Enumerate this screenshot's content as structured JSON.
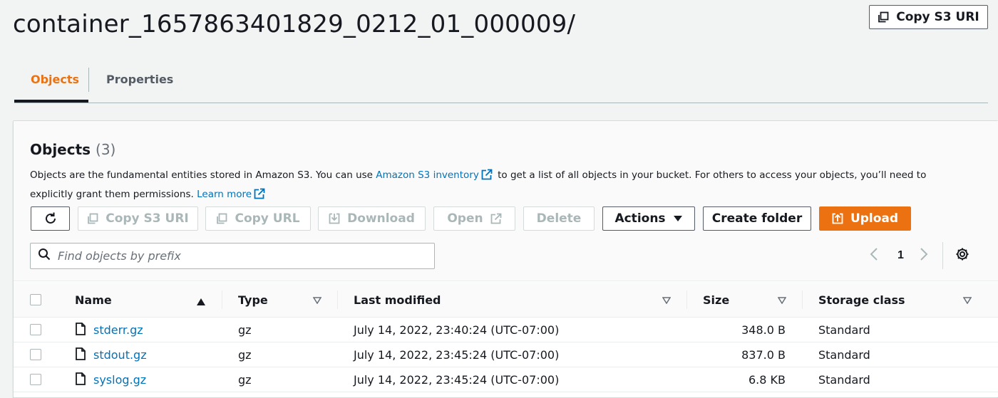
{
  "page": {
    "title": "container_1657863401829_0212_01_000009/",
    "copy_s3_uri_label": "Copy S3 URI"
  },
  "tabs": [
    {
      "label": "Objects",
      "active": true
    },
    {
      "label": "Properties",
      "active": false
    }
  ],
  "panel": {
    "title": "Objects",
    "count": "(3)",
    "description_part1": "Objects are the fundamental entities stored in Amazon S3. You can use ",
    "inventory_link": "Amazon S3 inventory",
    "description_part2": " to get a list of all objects in your bucket. For others to access your objects, you’ll need to explicitly grant them permissions. ",
    "learn_more_link": "Learn more"
  },
  "toolbar": {
    "refresh_icon": "refresh-icon",
    "copy_s3_uri_label": "Copy S3 URI",
    "copy_url_label": "Copy URL",
    "download_label": "Download",
    "open_label": "Open",
    "delete_label": "Delete",
    "actions_label": "Actions",
    "create_folder_label": "Create folder",
    "upload_label": "Upload"
  },
  "search": {
    "placeholder": "Find objects by prefix",
    "value": ""
  },
  "pagination": {
    "current_page": "1"
  },
  "table": {
    "columns": {
      "name": "Name",
      "type": "Type",
      "last_modified": "Last modified",
      "size": "Size",
      "storage_class": "Storage class"
    },
    "rows": [
      {
        "name": "stderr.gz",
        "type": "gz",
        "last_modified": "July 14, 2022, 23:40:24 (UTC-07:00)",
        "size": "348.0 B",
        "storage_class": "Standard"
      },
      {
        "name": "stdout.gz",
        "type": "gz",
        "last_modified": "July 14, 2022, 23:45:24 (UTC-07:00)",
        "size": "837.0 B",
        "storage_class": "Standard"
      },
      {
        "name": "syslog.gz",
        "type": "gz",
        "last_modified": "July 14, 2022, 23:45:24 (UTC-07:00)",
        "size": "6.8 KB",
        "storage_class": "Standard"
      }
    ]
  },
  "colors": {
    "accent": "#ec7211",
    "link": "#0073bb",
    "text": "#16191f",
    "disabled": "#aab7b8"
  }
}
